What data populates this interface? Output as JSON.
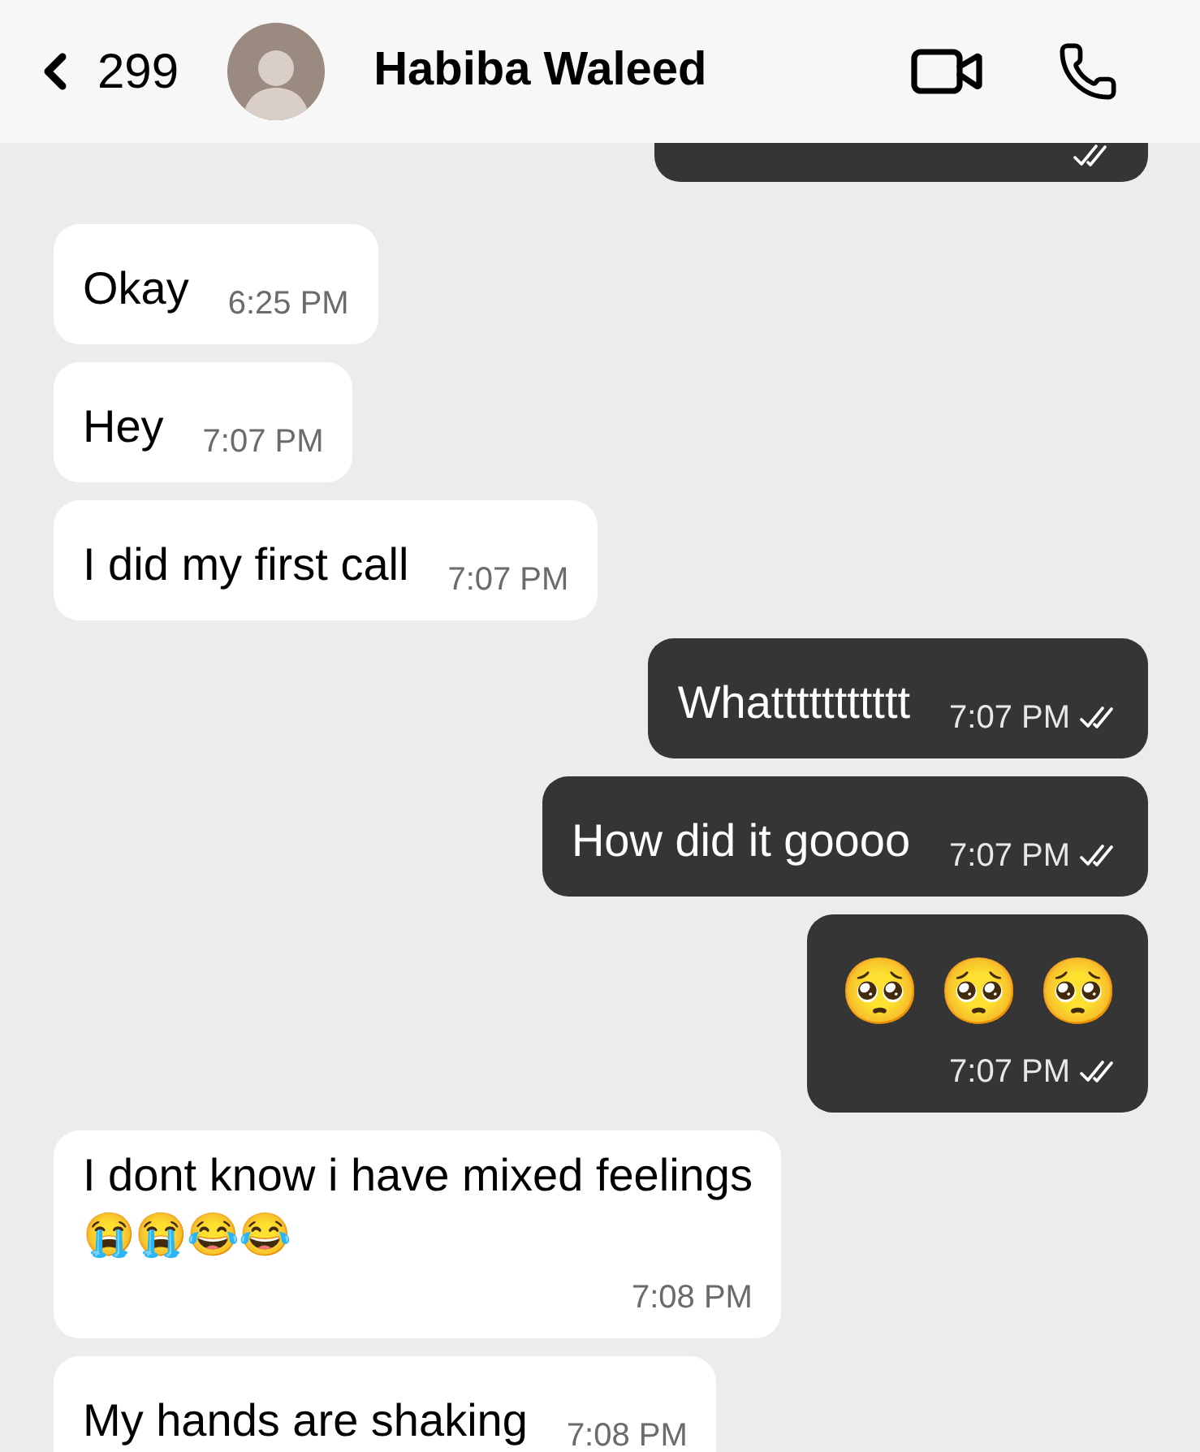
{
  "header": {
    "back_count": "299",
    "contact_name": "Habiba Waleed"
  },
  "top_partial": {
    "read": true
  },
  "messages": [
    {
      "kind": "in",
      "text": "Okay",
      "time": "6:25 PM"
    },
    {
      "kind": "in",
      "text": "Hey",
      "time": "7:07 PM"
    },
    {
      "kind": "in",
      "text": "I did my first call",
      "time": "7:07 PM"
    },
    {
      "kind": "out",
      "text": "Whattttttttttt",
      "time": "7:07 PM",
      "read": true
    },
    {
      "kind": "out",
      "text": "How did it goooo",
      "time": "7:07 PM",
      "read": true
    },
    {
      "kind": "out",
      "emojis": "🥺 🥺 🥺",
      "time": "7:07 PM",
      "read": true
    },
    {
      "kind": "in",
      "text": "I dont know i have mixed feelings",
      "emojis": "😭😭😂😂",
      "time": "7:08 PM"
    },
    {
      "kind": "in",
      "text": "My hands are shaking",
      "time": "7:08 PM"
    }
  ]
}
